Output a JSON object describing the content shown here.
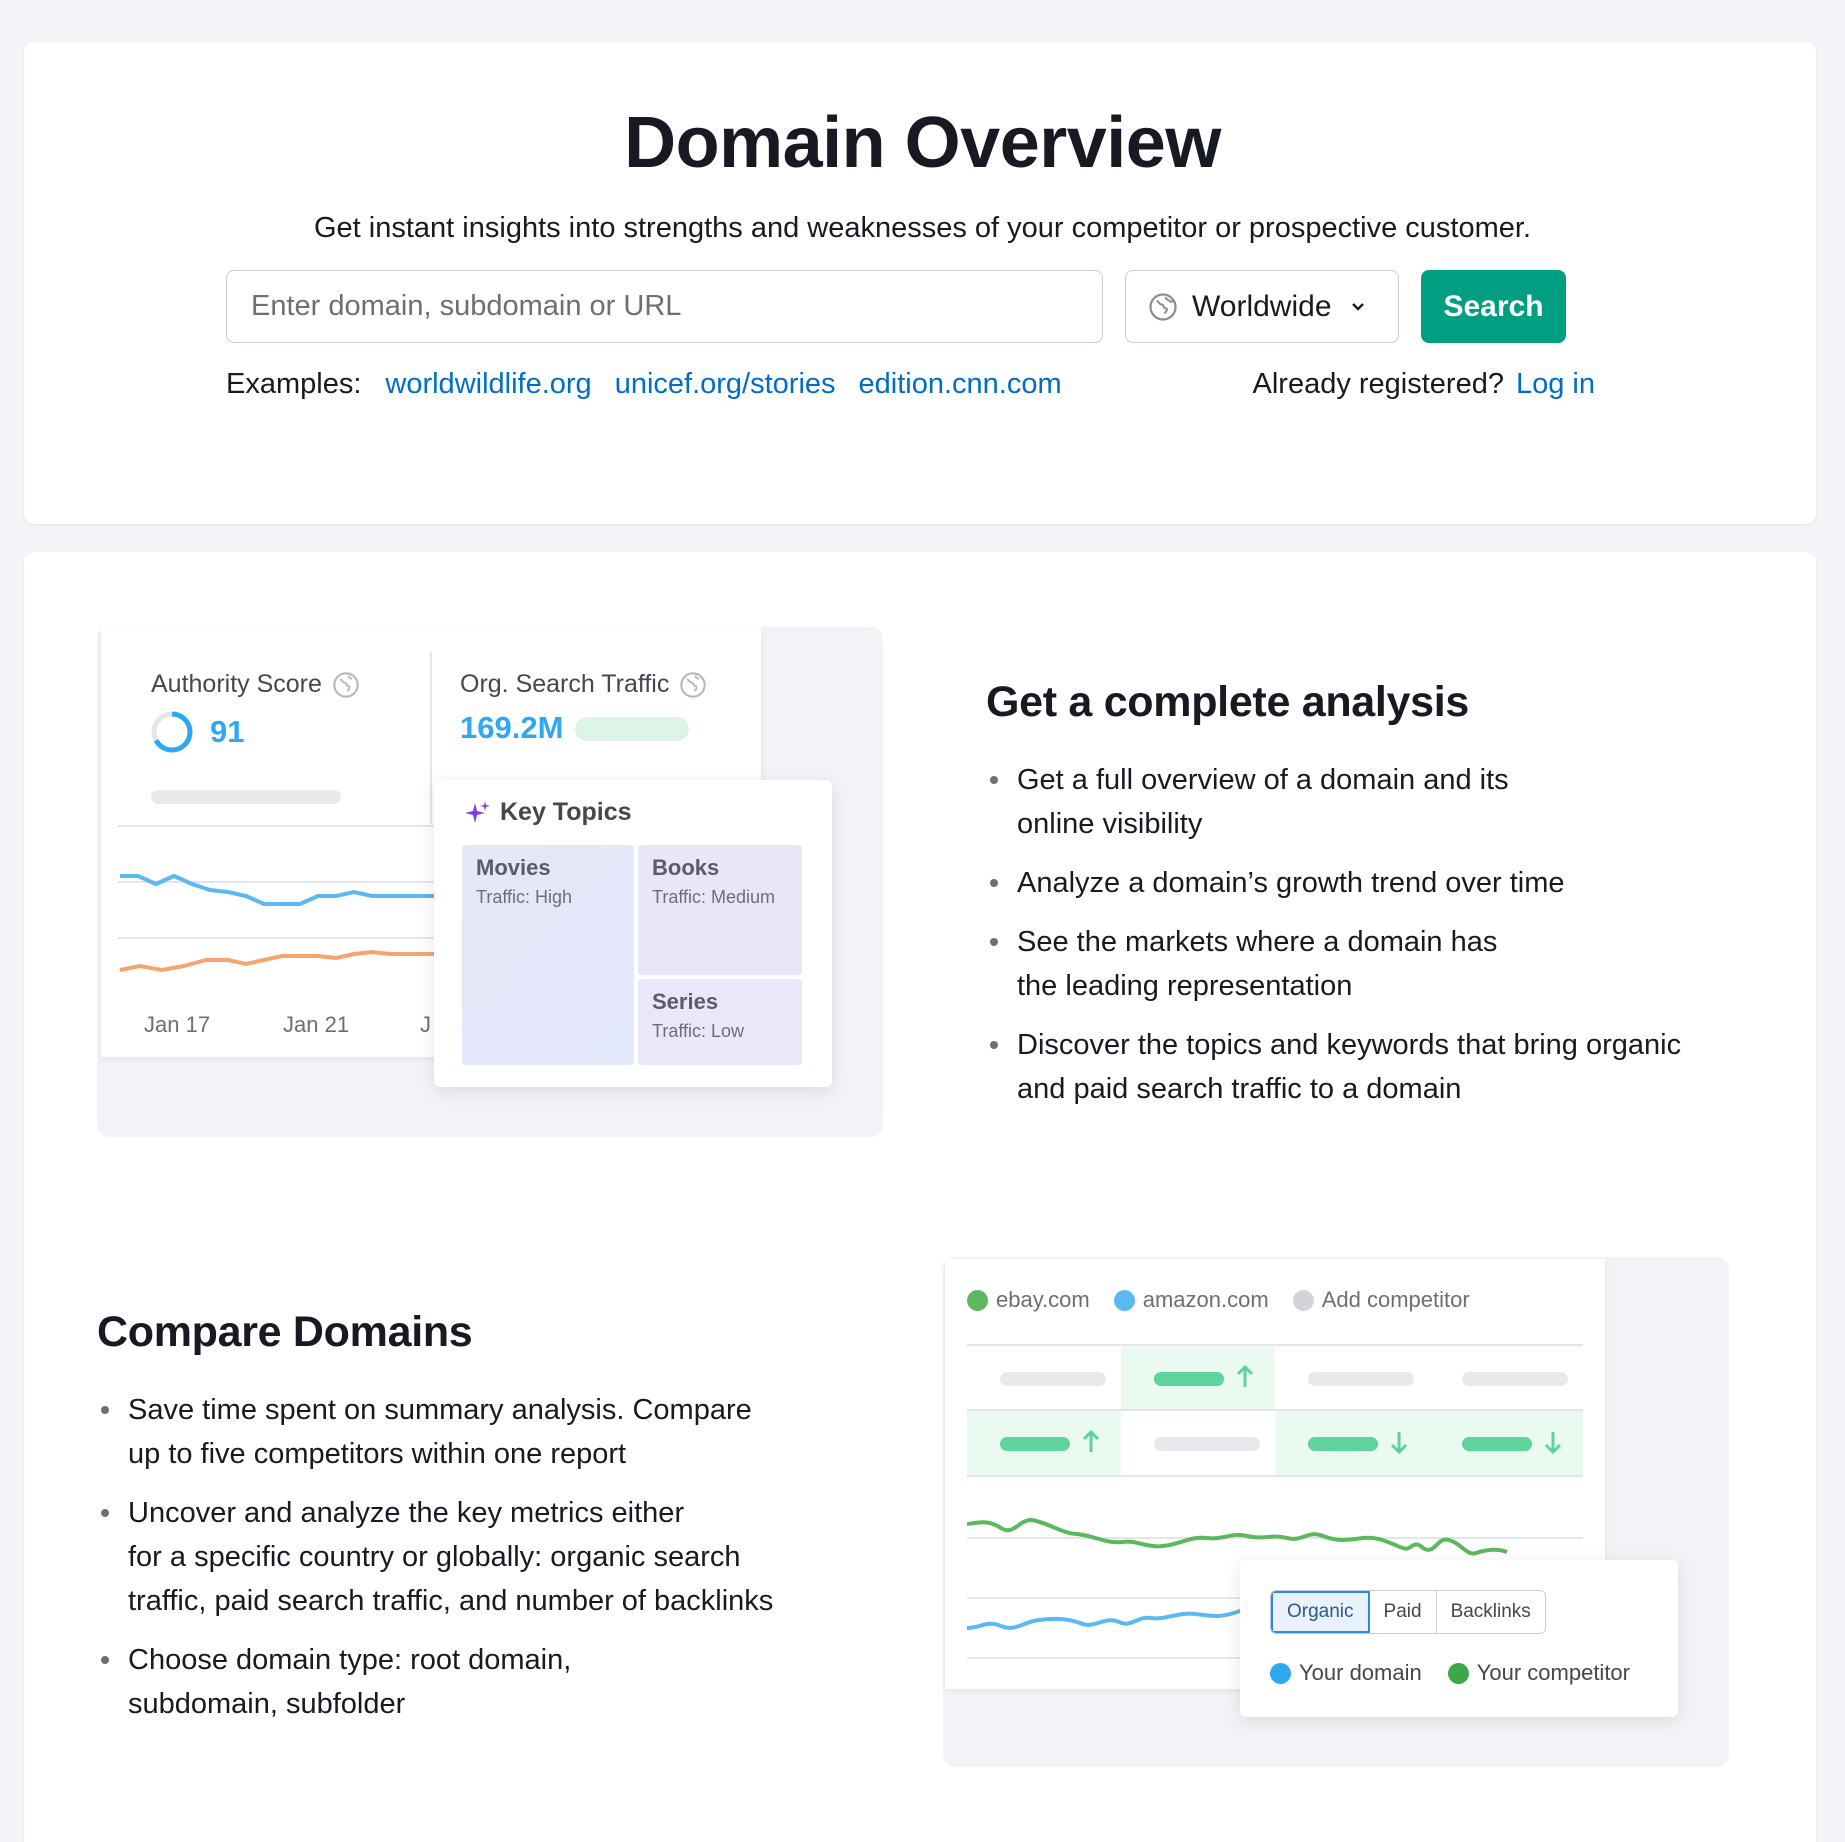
{
  "header": {
    "title": "Domain Overview",
    "subtitle": "Get instant insights into strengths and weaknesses of your competitor or prospective customer."
  },
  "search": {
    "placeholder": "Enter domain, subdomain or URL",
    "database": "Worldwide",
    "button_label": "Search"
  },
  "examples": {
    "label": "Examples:",
    "links": [
      "worldwildlife.org",
      "unicef.org/stories",
      "edition.cnn.com"
    ]
  },
  "login": {
    "question": "Already registered?",
    "link": "Log in"
  },
  "section1": {
    "heading": "Get a complete analysis",
    "bullets": [
      "Get a full overview of a domain and its",
      "online visibility",
      "Analyze a domain’s growth trend over time",
      "See the markets where a domain has",
      "the leading representation",
      "Discover the topics and keywords that bring organic",
      "and paid search traffic to a domain"
    ]
  },
  "illustration1": {
    "authority_label": "Authority Score",
    "authority_value": "91",
    "traffic_label": "Org. Search Traffic",
    "traffic_value": "169.2M",
    "axis": [
      "Jan 17",
      "Jan 21",
      "J"
    ],
    "key_topics": {
      "title": "Key Topics",
      "items": [
        {
          "name": "Movies",
          "traffic": "Traffic: High"
        },
        {
          "name": "Books",
          "traffic": "Traffic: Medium"
        },
        {
          "name": "Series",
          "traffic": "Traffic: Low"
        }
      ]
    }
  },
  "section2": {
    "heading": "Compare Domains",
    "bullets": [
      "Save time spent on summary analysis. Compare",
      "up to five competitors within one report",
      "Uncover and analyze the key metrics either",
      "for a specific country or globally: organic search",
      "traffic, paid search traffic, and number of backlinks",
      "Choose domain type: root domain,",
      "subdomain, subfolder"
    ]
  },
  "illustration2": {
    "domains": [
      "ebay.com",
      "amazon.com",
      "Add competitor"
    ],
    "tabs": [
      "Organic",
      "Paid",
      "Backlinks"
    ],
    "legend": [
      "Your domain",
      "Your competitor"
    ]
  },
  "colors": {
    "accent_green": "#009f81",
    "link_blue": "#006dca",
    "chart_blue": "#5bb8f0",
    "chart_orange": "#f4a46f",
    "chart_green": "#5cb85c"
  }
}
